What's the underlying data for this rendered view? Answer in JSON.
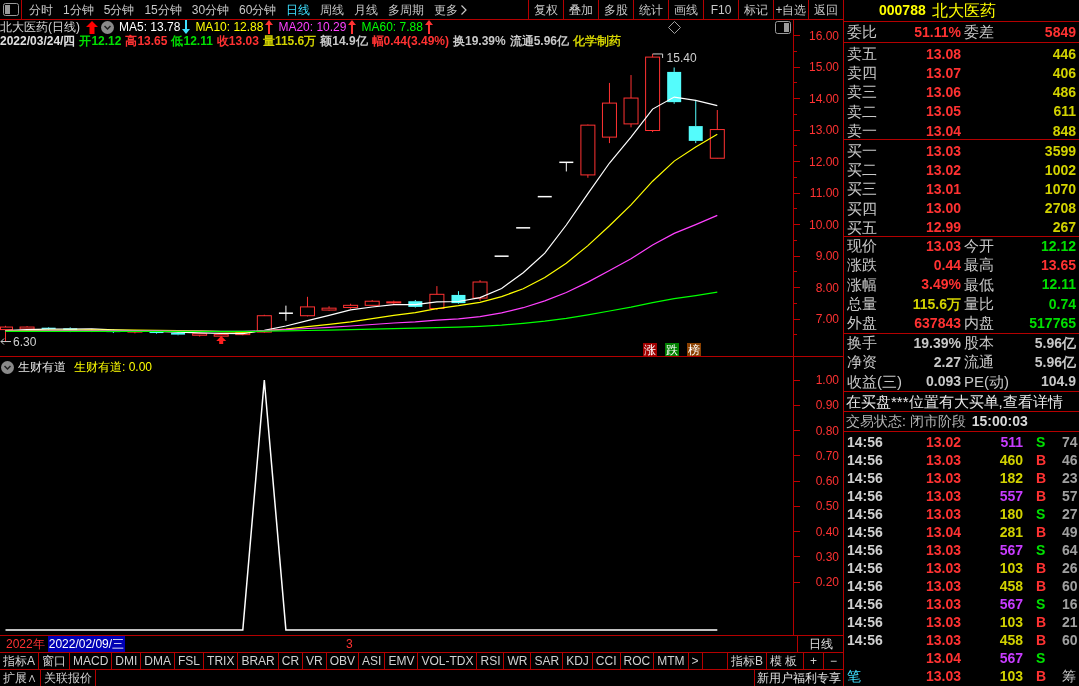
{
  "toolbar": {
    "periods": [
      {
        "label": "分时",
        "selected": false,
        "dropdown": false
      },
      {
        "label": "1分钟",
        "selected": false,
        "dropdown": false
      },
      {
        "label": "5分钟",
        "selected": false,
        "dropdown": false
      },
      {
        "label": "15分钟",
        "selected": false,
        "dropdown": false
      },
      {
        "label": "30分钟",
        "selected": false,
        "dropdown": false
      },
      {
        "label": "60分钟",
        "selected": false,
        "dropdown": false
      },
      {
        "label": "日线",
        "selected": true,
        "dropdown": false
      },
      {
        "label": "周线",
        "selected": false,
        "dropdown": false
      },
      {
        "label": "月线",
        "selected": false,
        "dropdown": false
      },
      {
        "label": "多周期",
        "selected": false,
        "dropdown": false
      },
      {
        "label": "更多",
        "selected": false,
        "dropdown": true
      }
    ],
    "buttons": [
      "复权",
      "叠加",
      "多股",
      "统计",
      "画线",
      "F10",
      "标记",
      "+自选",
      "返回"
    ]
  },
  "chart": {
    "title": "北大医药(日线)",
    "ma": [
      {
        "label": "MA5: 13.78",
        "color": "#ffffff",
        "arrow": {
          "kind": "down",
          "color": "#40e0ff"
        }
      },
      {
        "label": "MA10: 12.88",
        "color": "#ffff00",
        "arrow": {
          "kind": "up",
          "color": "#ff3232"
        }
      },
      {
        "label": "MA20: 10.29",
        "color": "#ff40ff",
        "arrow": {
          "kind": "up",
          "color": "#ff3232"
        }
      },
      {
        "label": "MA60: 7.88",
        "color": "#00ff00",
        "arrow": {
          "kind": "up",
          "color": "#ff3232"
        }
      }
    ],
    "info": [
      {
        "text": "2022/03/24/四",
        "color": "#e0e0e0"
      },
      {
        "text": "开12.12",
        "color": "#00e000"
      },
      {
        "text": "高13.65",
        "color": "#ff3232"
      },
      {
        "text": "低12.11",
        "color": "#00e000"
      },
      {
        "text": "收13.03",
        "color": "#ff3232"
      },
      {
        "text": "量115.6万",
        "color": "#d2d200"
      },
      {
        "text": "额14.9亿",
        "color": "#c8c8c8"
      },
      {
        "text": "幅0.44(3.49%)",
        "color": "#ff3232"
      },
      {
        "text": "换19.39%",
        "color": "#c8c8c8"
      },
      {
        "text": "流通5.96亿",
        "color": "#c8c8c8"
      },
      {
        "text": "化学制药",
        "color": "#d2d200"
      }
    ],
    "high_label": "15.40",
    "low_label": "6.30",
    "rank_buttons": [
      {
        "label": "涨",
        "color": "#a00000"
      },
      {
        "label": "跌",
        "color": "#008000"
      },
      {
        "label": "榜",
        "color": "#8a4000"
      }
    ],
    "price_axis": [
      "16.00",
      "15.00",
      "14.00",
      "13.00",
      "12.00",
      "11.00",
      "10.00",
      "9.00",
      "8.00",
      "7.00"
    ]
  },
  "indicator": {
    "title": "生财有道",
    "value_label": "生财有道: 0.00",
    "axis": [
      "1.00",
      "0.90",
      "0.80",
      "0.70",
      "0.60",
      "0.50",
      "0.40",
      "0.30",
      "0.20"
    ]
  },
  "date_axis": {
    "year": "2022年",
    "cursor_date": "2022/02/09/三",
    "month": "3",
    "period": "日线"
  },
  "indicator_tabs": {
    "left": [
      "指标A",
      "窗口",
      "MACD",
      "DMI",
      "DMA",
      "FSL",
      "TRIX",
      "BRAR",
      "CR",
      "VR",
      "OBV",
      "ASI",
      "EMV",
      "VOL-TDX",
      "RSI",
      "WR",
      "SAR",
      "KDJ",
      "CCI",
      "ROC",
      "MTM",
      ">"
    ],
    "right": [
      "指标B",
      "模板",
      "+",
      "−"
    ]
  },
  "bottom_bar": {
    "left": [
      "扩展∧",
      "关联报价"
    ],
    "right": "新用户福利专享"
  },
  "right_panel": {
    "code": "000788",
    "name": "北大医药",
    "commission": [
      {
        "label": "委比",
        "value": "51.11%"
      },
      {
        "label": "委差",
        "value": "5849"
      }
    ],
    "asks": [
      {
        "label": "卖五",
        "price": "13.08",
        "volume": "446"
      },
      {
        "label": "卖四",
        "price": "13.07",
        "volume": "406"
      },
      {
        "label": "卖三",
        "price": "13.06",
        "volume": "486"
      },
      {
        "label": "卖二",
        "price": "13.05",
        "volume": "611"
      },
      {
        "label": "卖一",
        "price": "13.04",
        "volume": "848"
      }
    ],
    "bids": [
      {
        "label": "买一",
        "price": "13.03",
        "volume": "3599"
      },
      {
        "label": "买二",
        "price": "13.02",
        "volume": "1002"
      },
      {
        "label": "买三",
        "price": "13.01",
        "volume": "1070"
      },
      {
        "label": "买四",
        "price": "13.00",
        "volume": "2708"
      },
      {
        "label": "买五",
        "price": "12.99",
        "volume": "267"
      }
    ],
    "stats": [
      [
        {
          "label": "现价",
          "value": "13.03",
          "color": "#ff3232"
        },
        {
          "label": "今开",
          "value": "12.12",
          "color": "#00e000"
        }
      ],
      [
        {
          "label": "涨跌",
          "value": "0.44",
          "color": "#ff3232"
        },
        {
          "label": "最高",
          "value": "13.65",
          "color": "#ff3232"
        }
      ],
      [
        {
          "label": "涨幅",
          "value": "3.49%",
          "color": "#ff3232"
        },
        {
          "label": "最低",
          "value": "12.11",
          "color": "#00e000"
        }
      ],
      [
        {
          "label": "总量",
          "value": "115.6万",
          "color": "#d2d200"
        },
        {
          "label": "量比",
          "value": "0.74",
          "color": "#00e000"
        }
      ],
      [
        {
          "label": "外盘",
          "value": "637843",
          "color": "#ff3232"
        },
        {
          "label": "内盘",
          "value": "517765",
          "color": "#00e000"
        }
      ]
    ],
    "fundamentals": [
      [
        {
          "label": "换手",
          "value": "19.39%"
        },
        {
          "label": "股本",
          "value": "5.96亿"
        }
      ],
      [
        {
          "label": "净资",
          "value": "2.27"
        },
        {
          "label": "流通",
          "value": "5.96亿"
        }
      ],
      [
        {
          "label": "收益(三)",
          "value": "0.093"
        },
        {
          "label": "PE(动)",
          "value": "104.9"
        }
      ]
    ],
    "notice": "在买盘***位置有大买单,查看详情",
    "status": "交易状态: 闭市阶段",
    "status_time": "15:00:03",
    "trades": [
      {
        "time": "14:56",
        "price": "13.02",
        "volume": "511",
        "color": "#c83cff",
        "flag": "S",
        "kind": "sell",
        "count": "74"
      },
      {
        "time": "14:56",
        "price": "13.03",
        "volume": "460",
        "color": "#d2d200",
        "flag": "B",
        "kind": "buy",
        "count": "46"
      },
      {
        "time": "14:56",
        "price": "13.03",
        "volume": "182",
        "color": "#d2d200",
        "flag": "B",
        "kind": "buy",
        "count": "23"
      },
      {
        "time": "14:56",
        "price": "13.03",
        "volume": "557",
        "color": "#c83cff",
        "flag": "B",
        "kind": "buy",
        "count": "57"
      },
      {
        "time": "14:56",
        "price": "13.03",
        "volume": "180",
        "color": "#d2d200",
        "flag": "S",
        "kind": "sell",
        "count": "27"
      },
      {
        "time": "14:56",
        "price": "13.04",
        "volume": "281",
        "color": "#d2d200",
        "flag": "B",
        "kind": "buy",
        "count": "49"
      },
      {
        "time": "14:56",
        "price": "13.03",
        "volume": "567",
        "color": "#c83cff",
        "flag": "S",
        "kind": "sell",
        "count": "64"
      },
      {
        "time": "14:56",
        "price": "13.03",
        "volume": "103",
        "color": "#d2d200",
        "flag": "B",
        "kind": "buy",
        "count": "26"
      },
      {
        "time": "14:56",
        "price": "13.03",
        "volume": "458",
        "color": "#d2d200",
        "flag": "B",
        "kind": "buy",
        "count": "60"
      },
      {
        "time": "14:56",
        "price": "13.03",
        "volume": "567",
        "color": "#c83cff",
        "flag": "S",
        "kind": "sell",
        "count": "16"
      },
      {
        "time": "14:56",
        "price": "13.03",
        "volume": "103",
        "color": "#d2d200",
        "flag": "B",
        "kind": "buy",
        "count": "21"
      },
      {
        "time": "14:56",
        "price": "13.03",
        "volume": "458",
        "color": "#d2d200",
        "flag": "B",
        "kind": "buy",
        "count": "60"
      },
      {
        "price": "13.04",
        "volume": "567",
        "color": "#c83cff",
        "flag": "S",
        "kind": "sell"
      }
    ],
    "last_row": {
      "tabs": [
        {
          "label": "笔",
          "selected": true
        },
        {
          "label": "筹",
          "selected": false
        }
      ],
      "price": "13.03",
      "volume": "103",
      "color": "#d2d200",
      "flag": "B",
      "kind": "buy"
    }
  }
}
